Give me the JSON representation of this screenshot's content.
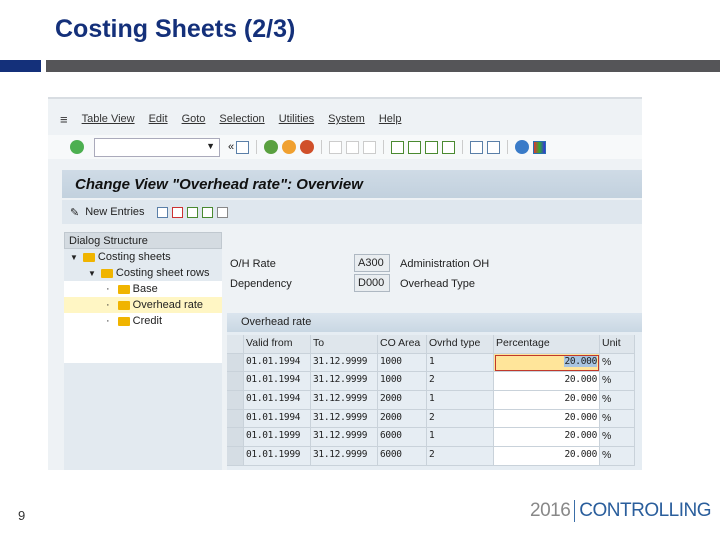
{
  "slide": {
    "title": "Costing Sheets (2/3)",
    "page_number": "9",
    "logo_year": "2016",
    "logo_text": "CONTROLLING"
  },
  "sap": {
    "menu": [
      "Table View",
      "Edit",
      "Goto",
      "Selection",
      "Utilities",
      "System",
      "Help"
    ],
    "command_field": "",
    "screen_title": "Change View \"Overhead rate\": Overview",
    "new_entries": "New Entries",
    "dialog_structure": {
      "header": "Dialog Structure",
      "items": [
        "Costing sheets",
        "Costing sheet rows",
        "Base",
        "Overhead rate",
        "Credit"
      ],
      "selected": "Overhead rate"
    },
    "fields": {
      "oh_rate_label": "O/H Rate",
      "oh_rate_value": "A300",
      "oh_rate_desc": "Administration OH",
      "dependency_label": "Dependency",
      "dependency_value": "D000",
      "dependency_desc": "Overhead Type"
    },
    "table": {
      "title": "Overhead rate",
      "columns": [
        "Valid from",
        "To",
        "CO Area",
        "Ovrhd type",
        "Percentage",
        "Unit"
      ],
      "rows": [
        [
          "01.01.1994",
          "31.12.9999",
          "1000",
          "1",
          "20.000",
          "%"
        ],
        [
          "01.01.1994",
          "31.12.9999",
          "1000",
          "2",
          "20.000",
          "%"
        ],
        [
          "01.01.1994",
          "31.12.9999",
          "2000",
          "1",
          "20.000",
          "%"
        ],
        [
          "01.01.1994",
          "31.12.9999",
          "2000",
          "2",
          "20.000",
          "%"
        ],
        [
          "01.01.1999",
          "31.12.9999",
          "6000",
          "1",
          "20.000",
          "%"
        ],
        [
          "01.01.1999",
          "31.12.9999",
          "6000",
          "2",
          "20.000",
          "%"
        ]
      ]
    },
    "colors": {
      "accent": "#14307a",
      "bar": "#555558",
      "folder": "#f0b400"
    }
  }
}
